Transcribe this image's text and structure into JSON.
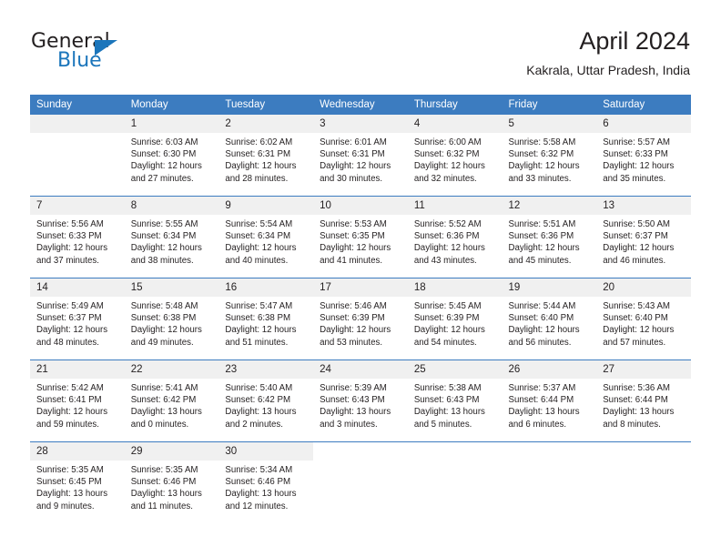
{
  "brand": {
    "name_part1": "General",
    "name_part2": "Blue",
    "accent_color": "#1b75bb"
  },
  "header": {
    "title": "April 2024",
    "subtitle": "Kakrala, Uttar Pradesh, India"
  },
  "calendar": {
    "header_bg": "#3c7cc0",
    "daynum_bg": "#f0f0f0",
    "weekdays": [
      "Sunday",
      "Monday",
      "Tuesday",
      "Wednesday",
      "Thursday",
      "Friday",
      "Saturday"
    ],
    "weeks": [
      [
        {
          "day": "",
          "sunrise": "",
          "sunset": "",
          "daylight1": "",
          "daylight2": ""
        },
        {
          "day": "1",
          "sunrise": "Sunrise: 6:03 AM",
          "sunset": "Sunset: 6:30 PM",
          "daylight1": "Daylight: 12 hours",
          "daylight2": "and 27 minutes."
        },
        {
          "day": "2",
          "sunrise": "Sunrise: 6:02 AM",
          "sunset": "Sunset: 6:31 PM",
          "daylight1": "Daylight: 12 hours",
          "daylight2": "and 28 minutes."
        },
        {
          "day": "3",
          "sunrise": "Sunrise: 6:01 AM",
          "sunset": "Sunset: 6:31 PM",
          "daylight1": "Daylight: 12 hours",
          "daylight2": "and 30 minutes."
        },
        {
          "day": "4",
          "sunrise": "Sunrise: 6:00 AM",
          "sunset": "Sunset: 6:32 PM",
          "daylight1": "Daylight: 12 hours",
          "daylight2": "and 32 minutes."
        },
        {
          "day": "5",
          "sunrise": "Sunrise: 5:58 AM",
          "sunset": "Sunset: 6:32 PM",
          "daylight1": "Daylight: 12 hours",
          "daylight2": "and 33 minutes."
        },
        {
          "day": "6",
          "sunrise": "Sunrise: 5:57 AM",
          "sunset": "Sunset: 6:33 PM",
          "daylight1": "Daylight: 12 hours",
          "daylight2": "and 35 minutes."
        }
      ],
      [
        {
          "day": "7",
          "sunrise": "Sunrise: 5:56 AM",
          "sunset": "Sunset: 6:33 PM",
          "daylight1": "Daylight: 12 hours",
          "daylight2": "and 37 minutes."
        },
        {
          "day": "8",
          "sunrise": "Sunrise: 5:55 AM",
          "sunset": "Sunset: 6:34 PM",
          "daylight1": "Daylight: 12 hours",
          "daylight2": "and 38 minutes."
        },
        {
          "day": "9",
          "sunrise": "Sunrise: 5:54 AM",
          "sunset": "Sunset: 6:34 PM",
          "daylight1": "Daylight: 12 hours",
          "daylight2": "and 40 minutes."
        },
        {
          "day": "10",
          "sunrise": "Sunrise: 5:53 AM",
          "sunset": "Sunset: 6:35 PM",
          "daylight1": "Daylight: 12 hours",
          "daylight2": "and 41 minutes."
        },
        {
          "day": "11",
          "sunrise": "Sunrise: 5:52 AM",
          "sunset": "Sunset: 6:36 PM",
          "daylight1": "Daylight: 12 hours",
          "daylight2": "and 43 minutes."
        },
        {
          "day": "12",
          "sunrise": "Sunrise: 5:51 AM",
          "sunset": "Sunset: 6:36 PM",
          "daylight1": "Daylight: 12 hours",
          "daylight2": "and 45 minutes."
        },
        {
          "day": "13",
          "sunrise": "Sunrise: 5:50 AM",
          "sunset": "Sunset: 6:37 PM",
          "daylight1": "Daylight: 12 hours",
          "daylight2": "and 46 minutes."
        }
      ],
      [
        {
          "day": "14",
          "sunrise": "Sunrise: 5:49 AM",
          "sunset": "Sunset: 6:37 PM",
          "daylight1": "Daylight: 12 hours",
          "daylight2": "and 48 minutes."
        },
        {
          "day": "15",
          "sunrise": "Sunrise: 5:48 AM",
          "sunset": "Sunset: 6:38 PM",
          "daylight1": "Daylight: 12 hours",
          "daylight2": "and 49 minutes."
        },
        {
          "day": "16",
          "sunrise": "Sunrise: 5:47 AM",
          "sunset": "Sunset: 6:38 PM",
          "daylight1": "Daylight: 12 hours",
          "daylight2": "and 51 minutes."
        },
        {
          "day": "17",
          "sunrise": "Sunrise: 5:46 AM",
          "sunset": "Sunset: 6:39 PM",
          "daylight1": "Daylight: 12 hours",
          "daylight2": "and 53 minutes."
        },
        {
          "day": "18",
          "sunrise": "Sunrise: 5:45 AM",
          "sunset": "Sunset: 6:39 PM",
          "daylight1": "Daylight: 12 hours",
          "daylight2": "and 54 minutes."
        },
        {
          "day": "19",
          "sunrise": "Sunrise: 5:44 AM",
          "sunset": "Sunset: 6:40 PM",
          "daylight1": "Daylight: 12 hours",
          "daylight2": "and 56 minutes."
        },
        {
          "day": "20",
          "sunrise": "Sunrise: 5:43 AM",
          "sunset": "Sunset: 6:40 PM",
          "daylight1": "Daylight: 12 hours",
          "daylight2": "and 57 minutes."
        }
      ],
      [
        {
          "day": "21",
          "sunrise": "Sunrise: 5:42 AM",
          "sunset": "Sunset: 6:41 PM",
          "daylight1": "Daylight: 12 hours",
          "daylight2": "and 59 minutes."
        },
        {
          "day": "22",
          "sunrise": "Sunrise: 5:41 AM",
          "sunset": "Sunset: 6:42 PM",
          "daylight1": "Daylight: 13 hours",
          "daylight2": "and 0 minutes."
        },
        {
          "day": "23",
          "sunrise": "Sunrise: 5:40 AM",
          "sunset": "Sunset: 6:42 PM",
          "daylight1": "Daylight: 13 hours",
          "daylight2": "and 2 minutes."
        },
        {
          "day": "24",
          "sunrise": "Sunrise: 5:39 AM",
          "sunset": "Sunset: 6:43 PM",
          "daylight1": "Daylight: 13 hours",
          "daylight2": "and 3 minutes."
        },
        {
          "day": "25",
          "sunrise": "Sunrise: 5:38 AM",
          "sunset": "Sunset: 6:43 PM",
          "daylight1": "Daylight: 13 hours",
          "daylight2": "and 5 minutes."
        },
        {
          "day": "26",
          "sunrise": "Sunrise: 5:37 AM",
          "sunset": "Sunset: 6:44 PM",
          "daylight1": "Daylight: 13 hours",
          "daylight2": "and 6 minutes."
        },
        {
          "day": "27",
          "sunrise": "Sunrise: 5:36 AM",
          "sunset": "Sunset: 6:44 PM",
          "daylight1": "Daylight: 13 hours",
          "daylight2": "and 8 minutes."
        }
      ],
      [
        {
          "day": "28",
          "sunrise": "Sunrise: 5:35 AM",
          "sunset": "Sunset: 6:45 PM",
          "daylight1": "Daylight: 13 hours",
          "daylight2": "and 9 minutes."
        },
        {
          "day": "29",
          "sunrise": "Sunrise: 5:35 AM",
          "sunset": "Sunset: 6:46 PM",
          "daylight1": "Daylight: 13 hours",
          "daylight2": "and 11 minutes."
        },
        {
          "day": "30",
          "sunrise": "Sunrise: 5:34 AM",
          "sunset": "Sunset: 6:46 PM",
          "daylight1": "Daylight: 13 hours",
          "daylight2": "and 12 minutes."
        },
        {
          "day": "",
          "sunrise": "",
          "sunset": "",
          "daylight1": "",
          "daylight2": ""
        },
        {
          "day": "",
          "sunrise": "",
          "sunset": "",
          "daylight1": "",
          "daylight2": ""
        },
        {
          "day": "",
          "sunrise": "",
          "sunset": "",
          "daylight1": "",
          "daylight2": ""
        },
        {
          "day": "",
          "sunrise": "",
          "sunset": "",
          "daylight1": "",
          "daylight2": ""
        }
      ]
    ]
  }
}
